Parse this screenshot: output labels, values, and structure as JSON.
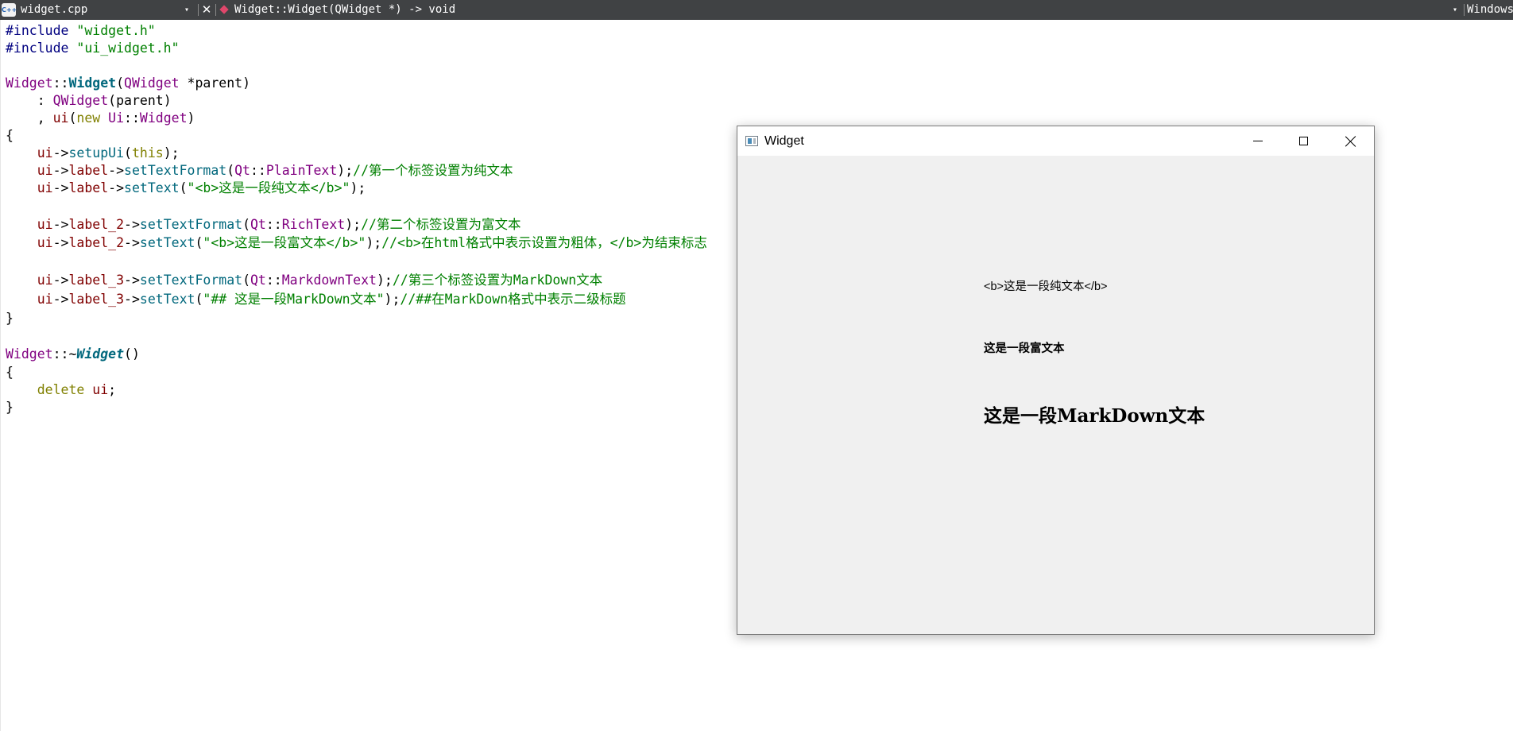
{
  "topbar": {
    "file_icon": "C++",
    "file_name": "widget.cpp",
    "dropdown_glyph": "▾",
    "close_glyph": "✕",
    "symbol": "Widget::Widget(QWidget *) -> void",
    "environment": "Windows"
  },
  "code": {
    "l1": {
      "a": "#include ",
      "b": "\"widget.h\""
    },
    "l2": {
      "a": "#include ",
      "b": "\"ui_widget.h\""
    },
    "l4": {
      "a": "Widget",
      "b": "::",
      "c": "Widget",
      "d": "(",
      "e": "QWidget",
      "f": " *",
      "g": "parent",
      "h": ")"
    },
    "l5": {
      "a": "    : ",
      "b": "QWidget",
      "c": "(",
      "d": "parent",
      "e": ")"
    },
    "l6": {
      "a": "    , ",
      "b": "ui",
      "c": "(",
      "d": "new",
      "e": " ",
      "f": "Ui",
      "g": "::",
      "h": "Widget",
      "i": ")"
    },
    "l7": {
      "a": "{"
    },
    "l8": {
      "a": "    ",
      "b": "ui",
      "c": "->",
      "d": "setupUi",
      "e": "(",
      "f": "this",
      "g": ");"
    },
    "l9": {
      "a": "    ",
      "b": "ui",
      "c": "->",
      "d": "label",
      "e": "->",
      "f": "setTextFormat",
      "g": "(",
      "h": "Qt",
      "i": "::",
      "j": "PlainText",
      "k": ");",
      "l": "//第一个标签设置为纯文本"
    },
    "l10": {
      "a": "    ",
      "b": "ui",
      "c": "->",
      "d": "label",
      "e": "->",
      "f": "setText",
      "g": "(",
      "h": "\"<b>这是一段纯文本</b>\"",
      "i": ");"
    },
    "l12": {
      "a": "    ",
      "b": "ui",
      "c": "->",
      "d": "label_2",
      "e": "->",
      "f": "setTextFormat",
      "g": "(",
      "h": "Qt",
      "i": "::",
      "j": "RichText",
      "k": ");",
      "l": "//第二个标签设置为富文本"
    },
    "l13": {
      "a": "    ",
      "b": "ui",
      "c": "->",
      "d": "label_2",
      "e": "->",
      "f": "setText",
      "g": "(",
      "h": "\"<b>这是一段富文本</b>\"",
      "i": ");",
      "j": "//<b>在html格式中表示设置为粗体，</b>为结束标志"
    },
    "l15": {
      "a": "    ",
      "b": "ui",
      "c": "->",
      "d": "label_3",
      "e": "->",
      "f": "setTextFormat",
      "g": "(",
      "h": "Qt",
      "i": "::",
      "j": "MarkdownText",
      "k": ");",
      "l": "//第三个标签设置为MarkDown文本"
    },
    "l16": {
      "a": "    ",
      "b": "ui",
      "c": "->",
      "d": "label_3",
      "e": "->",
      "f": "setText",
      "g": "(",
      "h": "\"## 这是一段MarkDown文本\"",
      "i": ");",
      "j": "//##在MarkDown格式中表示二级标题"
    },
    "l17": {
      "a": "}"
    },
    "l19": {
      "a": "Widget",
      "b": "::~",
      "c": "Widget",
      "d": "()"
    },
    "l20": {
      "a": "{"
    },
    "l21": {
      "a": "    ",
      "b": "delete",
      "c": " ",
      "d": "ui",
      "e": ";"
    },
    "l22": {
      "a": "}"
    }
  },
  "window": {
    "title": "Widget",
    "min_icon": "minimize-icon",
    "max_icon": "maximize-icon",
    "close_icon": "close-icon",
    "label_plain": "<b>这是一段纯文本</b>",
    "label_rich": "这是一段富文本",
    "label_markdown": "这是一段MarkDown文本"
  },
  "colors": {
    "topbar_bg": "#404244",
    "preprocessor": "#000080",
    "string": "#008000",
    "comment": "#008000",
    "class": "#800080",
    "function": "#00677c",
    "keyword": "#808000",
    "member": "#800000",
    "window_bg": "#f0f0f0"
  }
}
